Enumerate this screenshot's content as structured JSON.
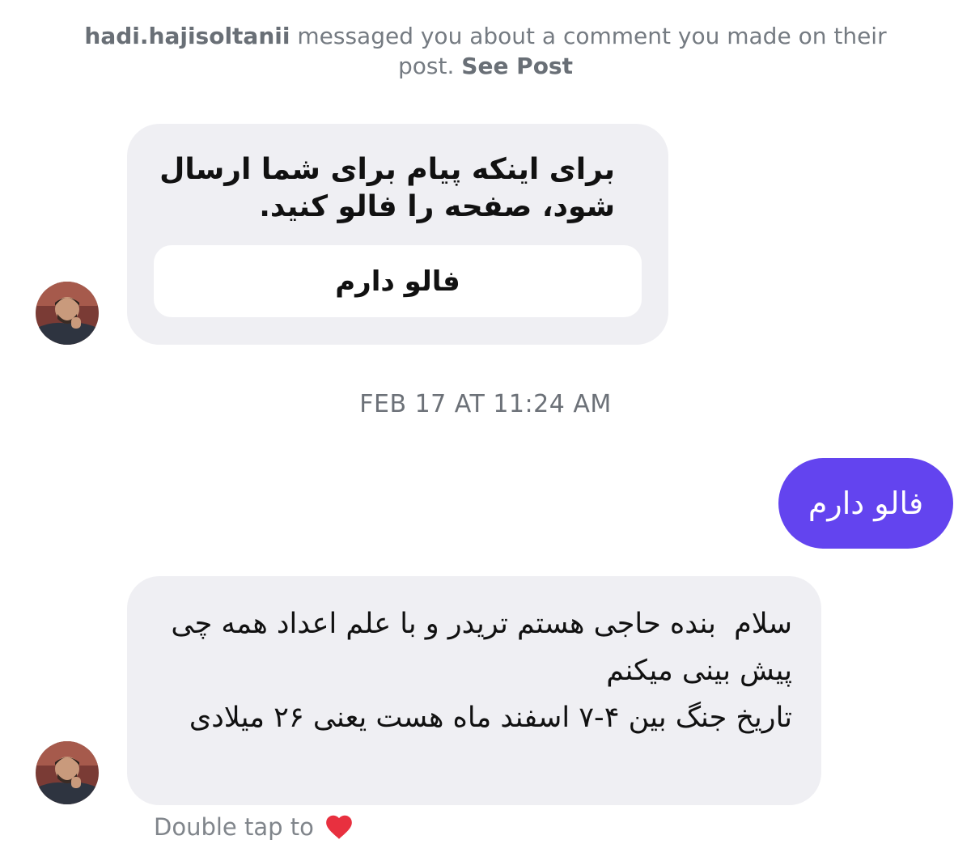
{
  "notice": {
    "username": "hadi.hajisoltanii",
    "text": " messaged you about a comment you made on their post. ",
    "link": "See Post"
  },
  "card": {
    "text": "برای اینکه پیام برای شما ارسال شود، صفحه را فالو کنید.",
    "button": "فالو دارم"
  },
  "timestamp": "FEB 17 AT 11:24 AM",
  "sent_message": "فالو دارم",
  "received_message": "سلام  بنده حاجی هستم تریدر و با علم اعداد همه چی پیش بینی میکنم\nتاریخ جنگ بین ۴-۷ اسفند ماه هست یعنی ۲۶ میلادی",
  "reaction_hint": {
    "text": "Double tap to",
    "icon": "heart-icon"
  },
  "colors": {
    "incoming_bubble": "#efeff3",
    "outgoing_bubble": "#6344ef",
    "heart": "#e8303f"
  }
}
